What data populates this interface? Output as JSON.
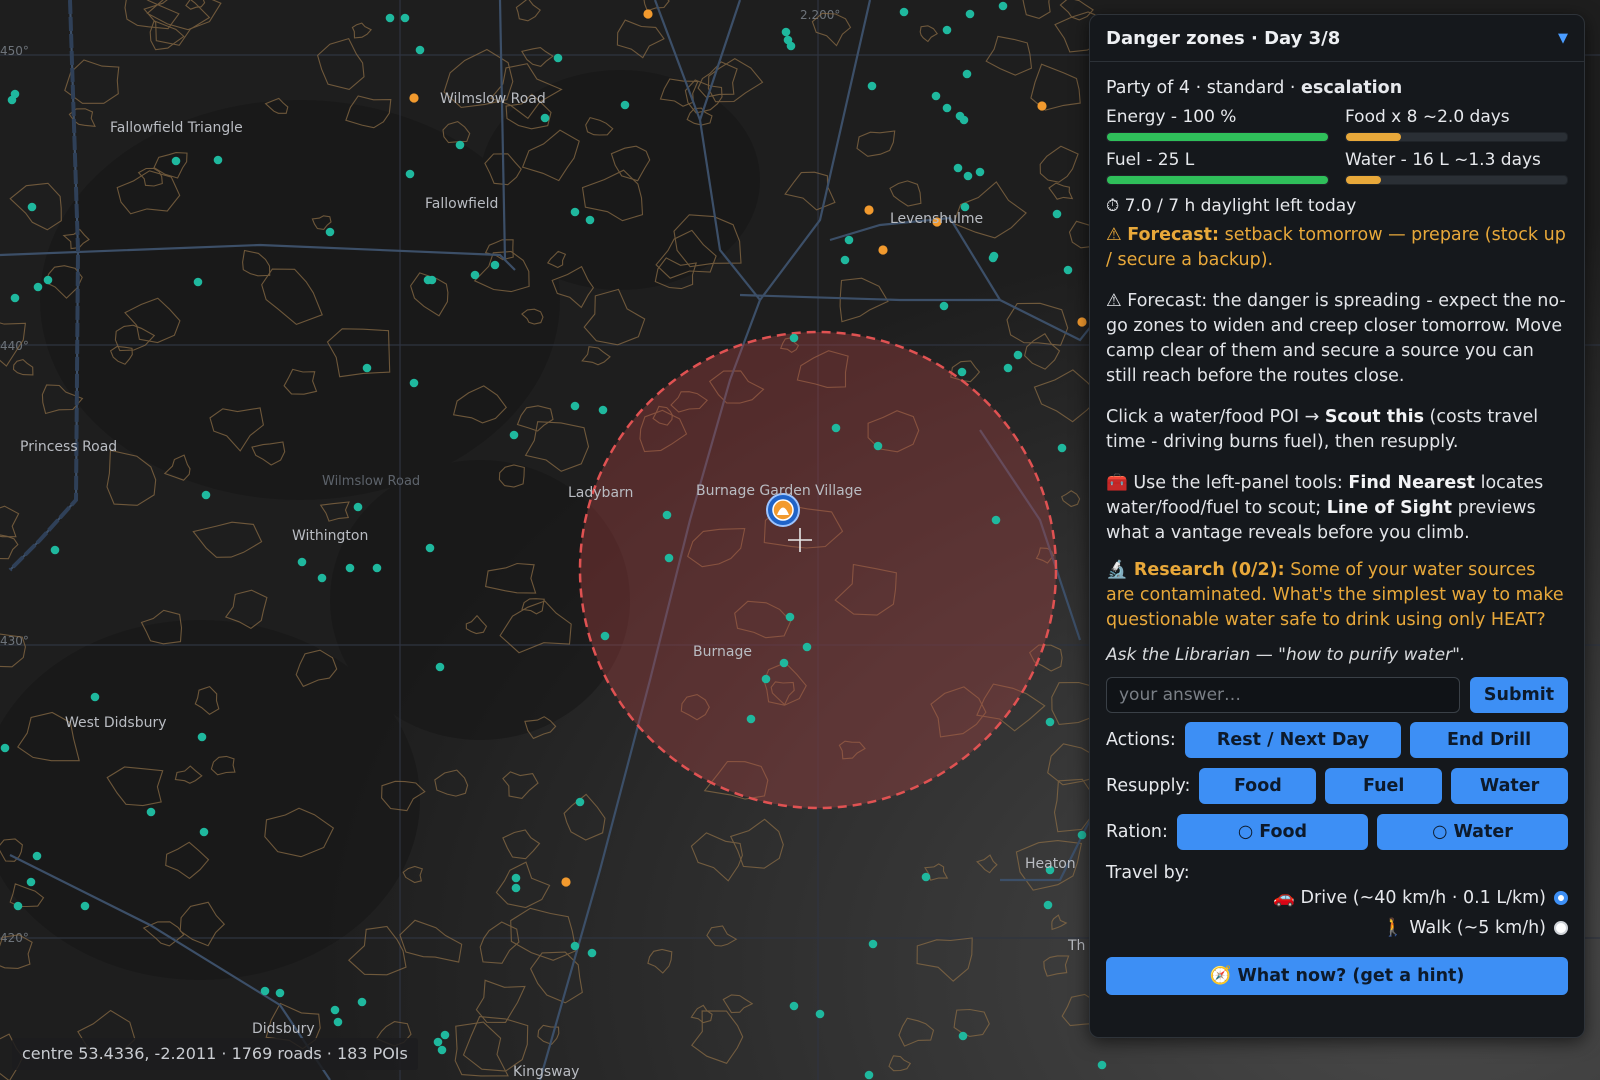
{
  "map": {
    "labels": {
      "fallowfield_triangle": "Fallowfield Triangle",
      "wilmslow_road_north": "Wilmslow Road",
      "fallowfield": "Fallowfield",
      "levenshulme": "Levenshulme",
      "princess_road": "Princess Road",
      "wilmslow_road_mid": "Wilmslow Road",
      "withington": "Withington",
      "ladybarn": "Ladybarn",
      "burnage_garden_village": "Burnage Garden Village",
      "burnage": "Burnage",
      "west_didsbury": "West Didsbury",
      "didsbury": "Didsbury",
      "kingsway": "Kingsway",
      "heaton_norris": "Heaton Norris",
      "heaton_partial": "Heaton",
      "th_partial": "Th"
    },
    "ticks": {
      "lat_450": "450°",
      "lat_440": "440°",
      "lat_430": "430°",
      "lat_420": "420°",
      "lon_2200": "2.200°"
    },
    "status": "centre 53.4336, -2.2011 · 1769 roads · 183 POIs",
    "colors": {
      "water_poi": "#1fb89e",
      "fuel_poi": "#f29a2e",
      "danger": "#e05252"
    }
  },
  "panel": {
    "title": "Danger zones · Day 3/8",
    "collapse_icon": "▼",
    "party": {
      "prefix": "Party of 4 · standard · ",
      "mode": "escalation"
    },
    "meters": [
      {
        "label": "Energy - 100 %",
        "level": 1.0,
        "color": "#2fbf5a"
      },
      {
        "label": "Food x 8 ~2.0 days",
        "level": 0.25,
        "color": "#e8a83a"
      },
      {
        "label": "Fuel - 25 L",
        "level": 1.0,
        "color": "#2fbf5a"
      },
      {
        "label": "Water - 16 L ~1.3 days",
        "level": 0.16,
        "color": "#e8a83a"
      }
    ],
    "daylight": "⏱ 7.0 / 7 h daylight left today",
    "forecast_short": {
      "icon": "⚠",
      "label": "Forecast:",
      "text": " setback tomorrow — prepare (stock up / secure a backup)."
    },
    "forecast_long": "⚠ Forecast: the danger is spreading - expect the no-go zones to widen and creep closer tomorrow. Move camp clear of them and secure a source you can still reach before the routes close.",
    "scout": {
      "pre": "Click a water/food POI → ",
      "bold": "Scout this",
      "post": " (costs travel time - driving burns fuel), then resupply."
    },
    "tools": {
      "icon": "🧰",
      "pre": " Use the left-panel tools: ",
      "b1": "Find Nearest",
      "mid": " locates water/food/fuel to scout; ",
      "b2": "Line of Sight",
      "post": " previews what a vantage reveals before you climb."
    },
    "research": {
      "icon": "🔬",
      "label": " Research (0/2):",
      "text": " Some of your water sources are contaminated. What's the simplest way to make questionable water safe to drink using only HEAT?"
    },
    "ask": "Ask the Librarian — \"how to purify water\".",
    "answer": {
      "placeholder": "your answer…",
      "value": ""
    },
    "submit_label": "Submit",
    "actions": {
      "label": "Actions:",
      "rest": "Rest / Next Day",
      "end": "End Drill"
    },
    "resupply": {
      "label": "Resupply:",
      "food": "Food",
      "fuel": "Fuel",
      "water": "Water"
    },
    "ration": {
      "label": "Ration:",
      "food": "○ Food",
      "water": "○ Water"
    },
    "travel": {
      "label": "Travel by:",
      "drive": "🚗 Drive (~40 km/h · 0.1 L/km)",
      "walk": "🚶 Walk (~5 km/h)",
      "selected": "drive"
    },
    "hint_label": "🧭 What now? (get a hint)"
  }
}
